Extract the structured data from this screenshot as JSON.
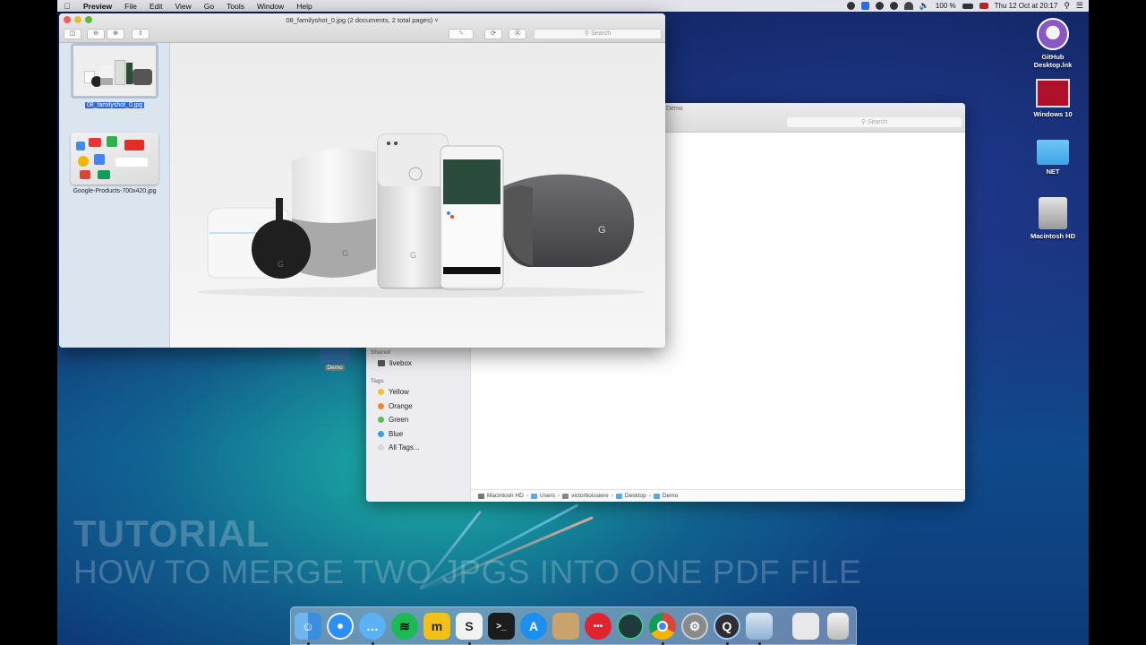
{
  "menubar": {
    "apple": "",
    "app_name": "Preview",
    "items": [
      "File",
      "Edit",
      "View",
      "Go",
      "Tools",
      "Window",
      "Help"
    ],
    "battery": "100 %",
    "datetime": "Thu 12 Oct at 20:17"
  },
  "tutorial": {
    "line1": "TUTORIAL",
    "line2": "HOW TO MERGE TWO JPGS INTO ONE PDF FILE"
  },
  "desktop_icons": [
    {
      "label_line1": "GitHub",
      "label_line2": "Desktop.lnk"
    },
    {
      "label_line1": "Windows 10",
      "label_line2": ""
    },
    {
      "label_line1": "NET",
      "label_line2": ""
    },
    {
      "label_line1": "Macintosh HD",
      "label_line2": ""
    }
  ],
  "preview": {
    "title": "08_familyshot_0.jpg (2 documents, 2 total pages) ˅",
    "search_placeholder": "Search",
    "thumbnails": [
      {
        "caption": "08_familyshot_0.jpg",
        "selected": true
      },
      {
        "caption": "Google-Products-700x420.jpg",
        "selected": false
      }
    ]
  },
  "finder": {
    "title": "Demo",
    "search_placeholder": "Search",
    "shared_header": "Shared",
    "shared_items": [
      "livebox"
    ],
    "tags_header": "Tags",
    "tags": [
      {
        "label": "Yellow",
        "color": "#f5c22e"
      },
      {
        "label": "Orange",
        "color": "#f0862a"
      },
      {
        "label": "Green",
        "color": "#56c152"
      },
      {
        "label": "Blue",
        "color": "#3b9fe6"
      },
      {
        "label": "All Tags...",
        "color": "#d8d8d8"
      }
    ],
    "path": [
      "Macintosh HD",
      "Users",
      "victorboissiere",
      "Desktop",
      "Demo"
    ]
  },
  "demo_desktop_folder": "Demo",
  "dock": {
    "apps": [
      "Finder",
      "Safari",
      "Messages",
      "Spotify",
      "Mail Plus",
      "Scrivener",
      "Terminal",
      "App Store",
      "Archive",
      "Parallels",
      "GitKraken",
      "Chrome",
      "System Preferences",
      "QuickTime",
      "Preview",
      "Documents",
      "Trash"
    ]
  }
}
